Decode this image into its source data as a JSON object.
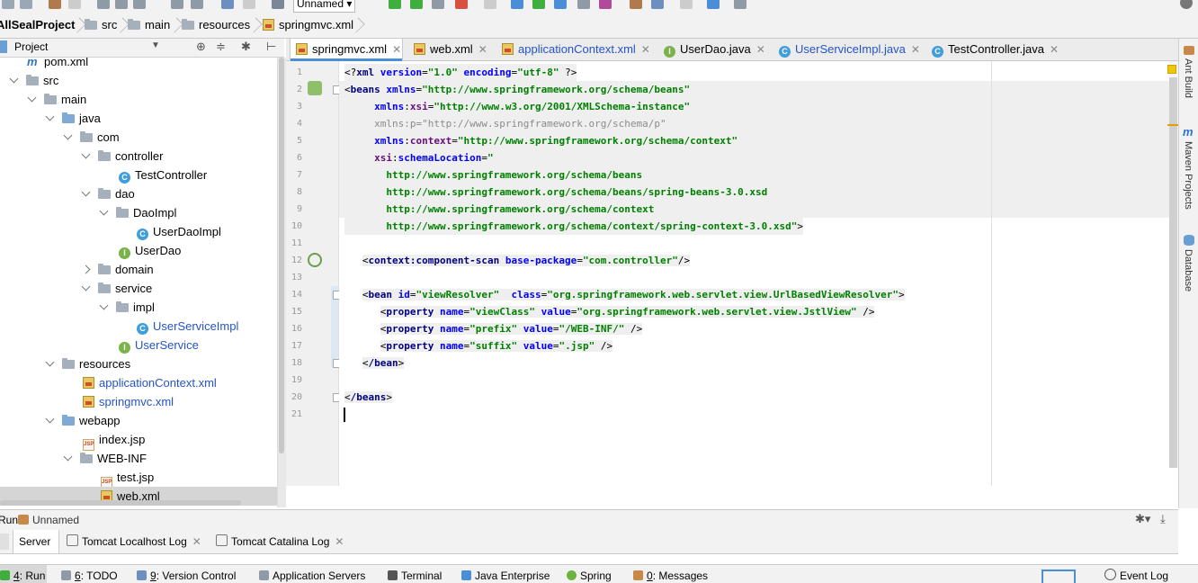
{
  "toolbar": {
    "run_config": "Unnamed"
  },
  "breadcrumb": {
    "project": "AllSealProject",
    "items": [
      "src",
      "main",
      "resources"
    ],
    "file": "springmvc.xml"
  },
  "project_panel": {
    "title": "Project",
    "tree": [
      {
        "label": "pom.xml"
      },
      {
        "label": "src"
      },
      {
        "label": "main"
      },
      {
        "label": "java"
      },
      {
        "label": "com"
      },
      {
        "label": "controller"
      },
      {
        "label": "TestController"
      },
      {
        "label": "dao"
      },
      {
        "label": "DaoImpl"
      },
      {
        "label": "UserDaoImpl"
      },
      {
        "label": "UserDao"
      },
      {
        "label": "domain"
      },
      {
        "label": "service"
      },
      {
        "label": "impl"
      },
      {
        "label": "UserServiceImpl"
      },
      {
        "label": "UserService"
      },
      {
        "label": "resources"
      },
      {
        "label": "applicationContext.xml"
      },
      {
        "label": "springmvc.xml"
      },
      {
        "label": "webapp"
      },
      {
        "label": "index.jsp"
      },
      {
        "label": "WEB-INF"
      },
      {
        "label": "test.jsp"
      },
      {
        "label": "web.xml"
      }
    ]
  },
  "editor_tabs": [
    {
      "label": "springmvc.xml",
      "active": true
    },
    {
      "label": "web.xml"
    },
    {
      "label": "applicationContext.xml"
    },
    {
      "label": "UserDao.java"
    },
    {
      "label": "UserServiceImpl.java"
    },
    {
      "label": "TestController.java"
    }
  ],
  "code": {
    "line_numbers": [
      "1",
      "2",
      "3",
      "4",
      "5",
      "6",
      "7",
      "8",
      "9",
      "10",
      "11",
      "12",
      "13",
      "14",
      "15",
      "16",
      "17",
      "18",
      "19",
      "20",
      "21"
    ],
    "l1": {
      "open": "<?",
      "tag": "xml",
      "a1": "version",
      "v1": "\"1.0\"",
      "a2": "encoding",
      "v2": "\"utf-8\"",
      "close": " ?>"
    },
    "l2": {
      "tag": "beans",
      "attr": "xmlns",
      "val": "\"http://www.springframework.org/schema/beans\""
    },
    "l3": {
      "ns": "xmlns",
      "attr": "xsi",
      "val": "\"http://www.w3.org/2001/XMLSchema-instance\""
    },
    "l4": {
      "text": "xmlns:p=\"http://www.springframework.org/schema/p\""
    },
    "l5": {
      "ns": "xmlns",
      "attr": "context",
      "val": "\"http://www.springframework.org/schema/context\""
    },
    "l6": {
      "ns": "xsi",
      "attr": "schemaLocation",
      "val": "\""
    },
    "l7": "http://www.springframework.org/schema/beans",
    "l8": "http://www.springframework.org/schema/beans/spring-beans-3.0.xsd",
    "l9": "http://www.springframework.org/schema/context",
    "l10": "http://www.springframework.org/schema/context/spring-context-3.0.xsd\"",
    "l12": {
      "tag": "context:component-scan",
      "attr": "base-package",
      "val": "\"com.controller\""
    },
    "l14": {
      "tag": "bean",
      "a1": "id",
      "v1": "\"viewResolver\"",
      "a2": "class",
      "v2": "\"org.springframework.web.servlet.view.UrlBasedViewResolver\""
    },
    "l15": {
      "tag": "property",
      "a1": "name",
      "v1": "\"viewClass\"",
      "a2": "value",
      "v2": "\"org.springframework.web.servlet.view.JstlView\""
    },
    "l16": {
      "tag": "property",
      "a1": "name",
      "v1": "\"prefix\"",
      "a2": "value",
      "v2": "\"/WEB-INF/\""
    },
    "l17": {
      "tag": "property",
      "a1": "name",
      "v1": "\"suffix\"",
      "a2": "value",
      "v2": "\".jsp\""
    },
    "l18": {
      "tag": "/bean"
    },
    "l20": {
      "tag": "/beans"
    }
  },
  "right_strip": [
    "Ant Build",
    "Maven Projects",
    "Database"
  ],
  "run_panel": {
    "title": "Run",
    "config": "Unnamed",
    "tabs": [
      "Server",
      "Tomcat Localhost Log",
      "Tomcat Catalina Log"
    ]
  },
  "status_bar": {
    "items": [
      {
        "key": "4",
        "label": ": Run"
      },
      {
        "key": "6",
        "label": ": TODO"
      },
      {
        "key": "9",
        "label": ": Version Control"
      },
      {
        "label": "Application Servers"
      },
      {
        "label": "Terminal"
      },
      {
        "label": "Java Enterprise"
      },
      {
        "label": "Spring"
      },
      {
        "key": "0",
        "label": ": Messages"
      }
    ],
    "event_log": "Event Log"
  },
  "colors": {
    "accent": "#4a8fd6",
    "xml_tag": "#000080",
    "xml_attr": "#0000ff",
    "xml_string": "#008000"
  }
}
